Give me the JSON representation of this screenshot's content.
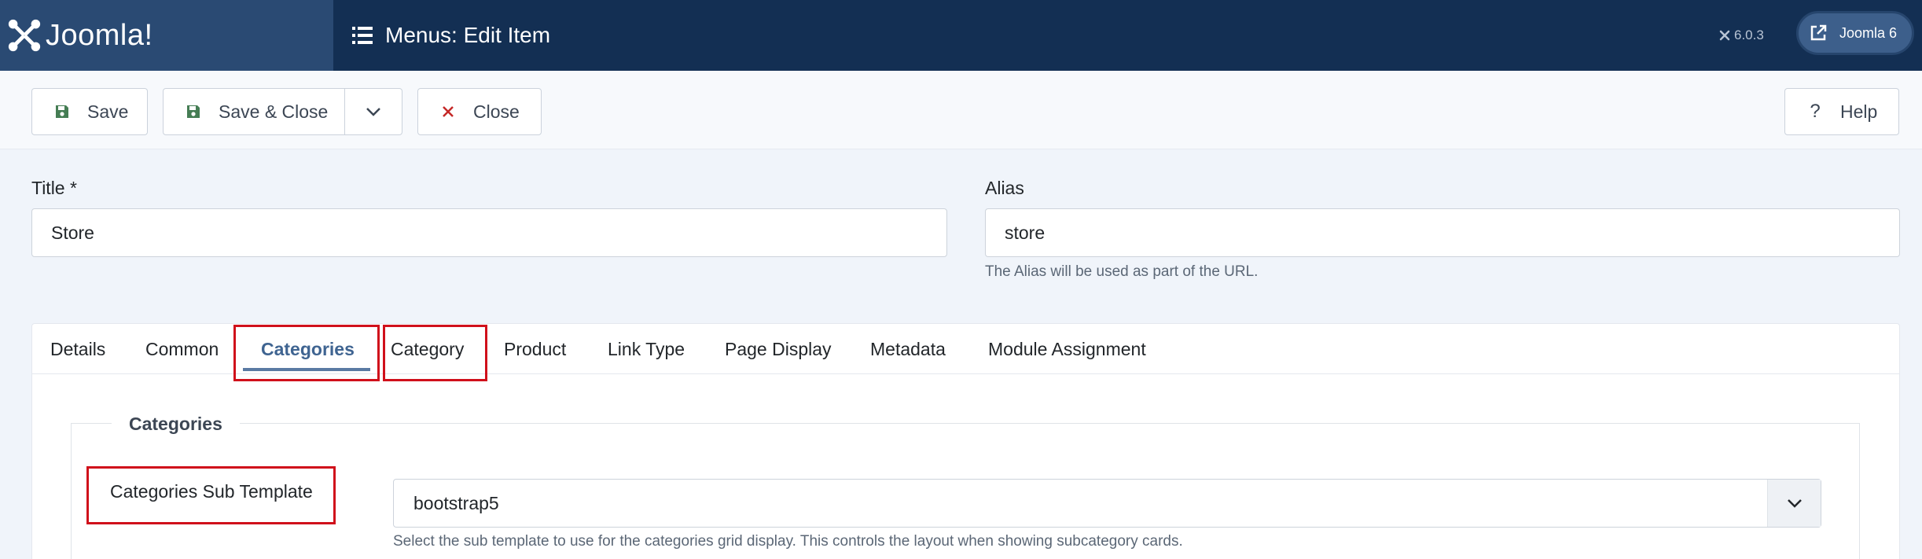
{
  "header": {
    "brand": "Joomla!",
    "page_title": "Menus: Edit Item",
    "version": "6.0.3",
    "site_button": "Joomla 6"
  },
  "toolbar": {
    "save": "Save",
    "save_close": "Save & Close",
    "close": "Close",
    "help": "Help"
  },
  "form": {
    "title_label": "Title *",
    "title_value": "Store",
    "alias_label": "Alias",
    "alias_value": "store",
    "alias_hint": "The Alias will be used as part of the URL."
  },
  "tabs": [
    {
      "label": "Details"
    },
    {
      "label": "Common"
    },
    {
      "label": "Categories"
    },
    {
      "label": "Category"
    },
    {
      "label": "Product"
    },
    {
      "label": "Link Type"
    },
    {
      "label": "Page Display"
    },
    {
      "label": "Metadata"
    },
    {
      "label": "Module Assignment"
    }
  ],
  "active_tab": "Categories",
  "section": {
    "legend": "Categories",
    "sub_template_label": "Categories Sub Template",
    "sub_template_value": "bootstrap5",
    "sub_template_hint": "Select the sub template to use for the categories grid display. This controls the layout when showing subcategory cards."
  },
  "colors": {
    "header_bg": "#132f53",
    "brand_bg": "#2a4a73",
    "highlight": "#d0101b",
    "active_tab": "#3f6491"
  }
}
